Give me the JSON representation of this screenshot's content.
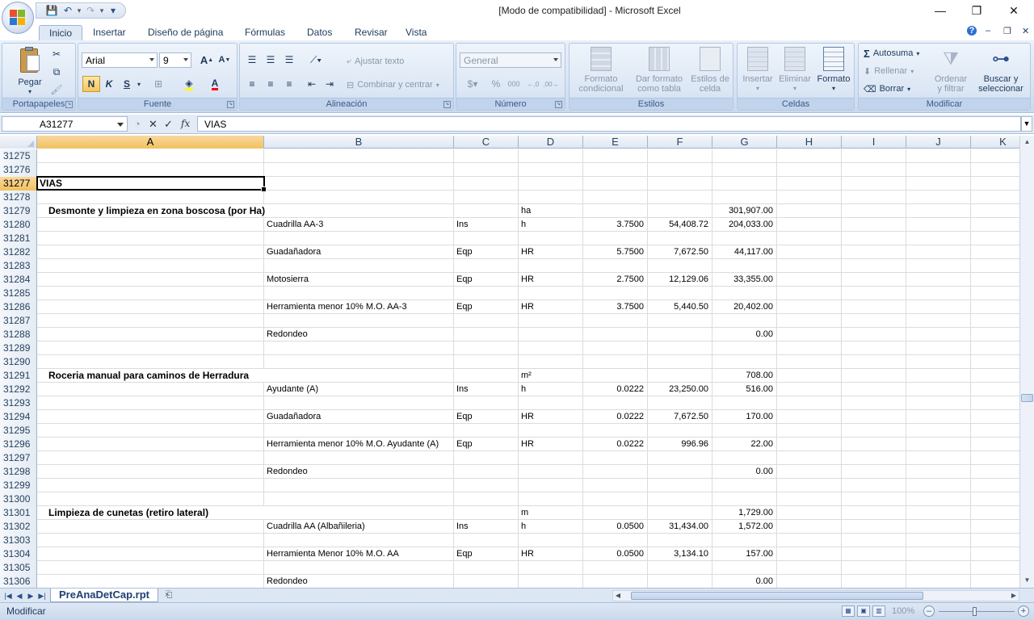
{
  "window": {
    "title": "[Modo de compatibilidad] - Microsoft Excel",
    "minimize": "—",
    "restore": "❐",
    "close": "✕"
  },
  "qat": {
    "save": "💾",
    "undo": "↶",
    "redo": "↷",
    "customize": "▾"
  },
  "tabs": [
    "Inicio",
    "Insertar",
    "Diseño de página",
    "Fórmulas",
    "Datos",
    "Revisar",
    "Vista"
  ],
  "tab_icons": {
    "help": "?",
    "min": "–",
    "restore": "❐",
    "close": "✕"
  },
  "ribbon": {
    "portapapeles": {
      "label": "Portapapeles",
      "pegar": "Pegar"
    },
    "fuente": {
      "label": "Fuente",
      "font": "Arial",
      "size": "9",
      "bold": "N",
      "italic": "K",
      "underline": "S",
      "grow": "A",
      "shrink": "A"
    },
    "alineacion": {
      "label": "Alineación",
      "ajustar": "Ajustar texto",
      "combinar": "Combinar y centrar"
    },
    "numero": {
      "label": "Número",
      "format": "General",
      "currency": "$",
      "percent": "%",
      "thousands": "000"
    },
    "estilos": {
      "label": "Estilos",
      "formato_condicional": [
        "Formato",
        "condicional"
      ],
      "dar_formato": [
        "Dar formato",
        "como tabla"
      ],
      "estilos_celda": [
        "Estilos de",
        "celda"
      ]
    },
    "celdas": {
      "label": "Celdas",
      "insertar": "Insertar",
      "eliminar": "Eliminar",
      "formato": "Formato"
    },
    "modificar": {
      "label": "Modificar",
      "autosuma": "Autosuma",
      "rellenar": "Rellenar",
      "borrar": "Borrar",
      "ordenar": [
        "Ordenar",
        "y filtrar"
      ],
      "buscar": [
        "Buscar y",
        "seleccionar"
      ]
    }
  },
  "formula_bar": {
    "name_box": "A31277",
    "fx": "fx",
    "content": "VIAS"
  },
  "columns": [
    "A",
    "B",
    "C",
    "D",
    "E",
    "F",
    "G",
    "H",
    "I",
    "J",
    "K"
  ],
  "selected": {
    "row": "31277",
    "col": "A"
  },
  "rows": [
    {
      "n": "31275"
    },
    {
      "n": "31276"
    },
    {
      "n": "31277",
      "A": "VIAS",
      "bold": true
    },
    {
      "n": "31278"
    },
    {
      "n": "31279",
      "A": "Desmonte y limpieza en zona boscosa (por Ha)",
      "bold": true,
      "indent": true,
      "D": "ha",
      "G": "301,907.00"
    },
    {
      "n": "31280",
      "B": "Cuadrilla AA-3",
      "C": "Ins",
      "D": "h",
      "E": "3.7500",
      "F": "54,408.72",
      "G": "204,033.00"
    },
    {
      "n": "31281"
    },
    {
      "n": "31282",
      "B": "Guadañadora",
      "C": "Eqp",
      "D": "HR",
      "E": "5.7500",
      "F": "7,672.50",
      "G": "44,117.00"
    },
    {
      "n": "31283"
    },
    {
      "n": "31284",
      "B": "Motosierra",
      "C": "Eqp",
      "D": "HR",
      "E": "2.7500",
      "F": "12,129.06",
      "G": "33,355.00"
    },
    {
      "n": "31285"
    },
    {
      "n": "31286",
      "B": "Herramienta menor 10% M.O. AA-3",
      "C": "Eqp",
      "D": "HR",
      "E": "3.7500",
      "F": "5,440.50",
      "G": "20,402.00"
    },
    {
      "n": "31287"
    },
    {
      "n": "31288",
      "B": "Redondeo",
      "G": "0.00"
    },
    {
      "n": "31289"
    },
    {
      "n": "31290"
    },
    {
      "n": "31291",
      "A": "Roceria manual para caminos de Herradura",
      "bold": true,
      "indent": true,
      "D": "m²",
      "G": "708.00"
    },
    {
      "n": "31292",
      "B": "Ayudante (A)",
      "C": "Ins",
      "D": "h",
      "E": "0.0222",
      "F": "23,250.00",
      "G": "516.00"
    },
    {
      "n": "31293"
    },
    {
      "n": "31294",
      "B": "Guadañadora",
      "C": "Eqp",
      "D": "HR",
      "E": "0.0222",
      "F": "7,672.50",
      "G": "170.00"
    },
    {
      "n": "31295"
    },
    {
      "n": "31296",
      "B": "Herramienta menor 10% M.O. Ayudante (A)",
      "C": "Eqp",
      "D": "HR",
      "E": "0.0222",
      "F": "996.96",
      "G": "22.00"
    },
    {
      "n": "31297"
    },
    {
      "n": "31298",
      "B": "Redondeo",
      "G": "0.00"
    },
    {
      "n": "31299"
    },
    {
      "n": "31300"
    },
    {
      "n": "31301",
      "A": "Limpieza de cunetas (retiro lateral)",
      "bold": true,
      "indent": true,
      "D": "m",
      "G": "1,729.00"
    },
    {
      "n": "31302",
      "B": "Cuadrilla  AA (Albañileria)",
      "C": "Ins",
      "D": "h",
      "E": "0.0500",
      "F": "31,434.00",
      "G": "1,572.00"
    },
    {
      "n": "31303"
    },
    {
      "n": "31304",
      "B": "Herramienta Menor 10% M.O. AA",
      "C": "Eqp",
      "D": "HR",
      "E": "0.0500",
      "F": "3,134.10",
      "G": "157.00"
    },
    {
      "n": "31305"
    },
    {
      "n": "31306",
      "B": "Redondeo",
      "G": "0.00"
    }
  ],
  "sheet": {
    "name": "PreAnaDetCap.rpt"
  },
  "status": {
    "mode": "Modificar",
    "zoom": "100%"
  }
}
